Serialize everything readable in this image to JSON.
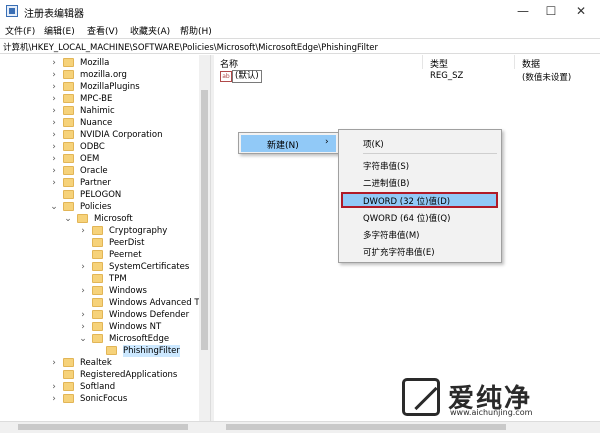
{
  "window": {
    "title": "注册表编辑器",
    "minimize": "—",
    "maximize": "☐",
    "close": "✕"
  },
  "menu": [
    "文件(F)",
    "编辑(E)",
    "查看(V)",
    "收藏夹(A)",
    "帮助(H)"
  ],
  "address": "计算机\\HKEY_LOCAL_MACHINE\\SOFTWARE\\Policies\\Microsoft\\MicrosoftEdge\\PhishingFilter",
  "tree": [
    {
      "label": "Mozilla",
      "exp": "›"
    },
    {
      "label": "mozilla.org",
      "exp": "›"
    },
    {
      "label": "MozillaPlugins",
      "exp": "›"
    },
    {
      "label": "MPC-BE",
      "exp": "›"
    },
    {
      "label": "Nahimic",
      "exp": "›"
    },
    {
      "label": "Nuance",
      "exp": "›"
    },
    {
      "label": "NVIDIA Corporation",
      "exp": "›"
    },
    {
      "label": "ODBC",
      "exp": "›"
    },
    {
      "label": "OEM",
      "exp": "›"
    },
    {
      "label": "Oracle",
      "exp": "›"
    },
    {
      "label": "Partner",
      "exp": "›"
    },
    {
      "label": "PELOGON",
      "exp": ""
    },
    {
      "label": "Policies",
      "exp": "⌄"
    },
    {
      "label": "Microsoft",
      "exp": "⌄"
    },
    {
      "label": "Cryptography",
      "exp": "›"
    },
    {
      "label": "PeerDist",
      "exp": ""
    },
    {
      "label": "Peernet",
      "exp": ""
    },
    {
      "label": "SystemCertificates",
      "exp": "›"
    },
    {
      "label": "TPM",
      "exp": ""
    },
    {
      "label": "Windows",
      "exp": "›"
    },
    {
      "label": "Windows Advanced Th",
      "exp": ""
    },
    {
      "label": "Windows Defender",
      "exp": "›"
    },
    {
      "label": "Windows NT",
      "exp": "›"
    },
    {
      "label": "MicrosoftEdge",
      "exp": "⌄"
    },
    {
      "label": "PhishingFilter",
      "exp": ""
    },
    {
      "label": "Realtek",
      "exp": "›"
    },
    {
      "label": "RegisteredApplications",
      "exp": ""
    },
    {
      "label": "Softland",
      "exp": "›"
    },
    {
      "label": "SonicFocus",
      "exp": "›"
    }
  ],
  "list": {
    "headers": {
      "name": "名称",
      "type": "类型",
      "data": "数据"
    },
    "row": {
      "icon": "ab",
      "name": "(默认)",
      "type": "REG_SZ",
      "data": "(数值未设置)"
    }
  },
  "context": {
    "new_label": "新建(N)",
    "arrow": "›",
    "items": [
      "项(K)",
      "字符串值(S)",
      "二进制值(B)",
      "DWORD (32 位)值(D)",
      "QWORD (64 位)值(Q)",
      "多字符串值(M)",
      "可扩充字符串值(E)"
    ]
  },
  "watermark": {
    "cn": "爱纯净",
    "url": "www.aichunjing.com"
  }
}
